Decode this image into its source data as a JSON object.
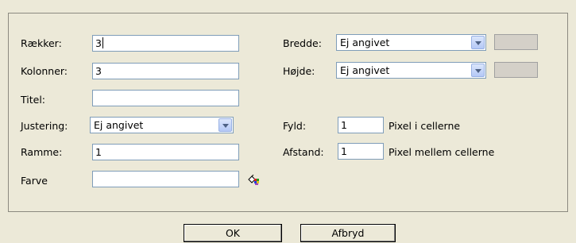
{
  "left": {
    "rows": {
      "label": "Rækker:",
      "value": "3"
    },
    "cols": {
      "label": "Kolonner:",
      "value": "3"
    },
    "title": {
      "label": "Titel:",
      "value": ""
    },
    "align": {
      "label": "Justering:",
      "value": "Ej angivet"
    },
    "border": {
      "label": "Ramme:",
      "value": "1"
    },
    "color": {
      "label": "Farve",
      "value": ""
    }
  },
  "right": {
    "width": {
      "label": "Bredde:",
      "value": "Ej angivet"
    },
    "height": {
      "label": "Højde:",
      "value": "Ej angivet"
    },
    "padding": {
      "label": "Fyld:",
      "value": "1",
      "unit": "Pixel i cellerne"
    },
    "spacing": {
      "label": "Afstand:",
      "value": "1",
      "unit": "Pixel mellem cellerne"
    }
  },
  "buttons": {
    "ok": "OK",
    "cancel": "Afbryd"
  },
  "icons": {
    "color_picker": "color-picker-icon",
    "dropdown": "chevron-down-icon"
  }
}
